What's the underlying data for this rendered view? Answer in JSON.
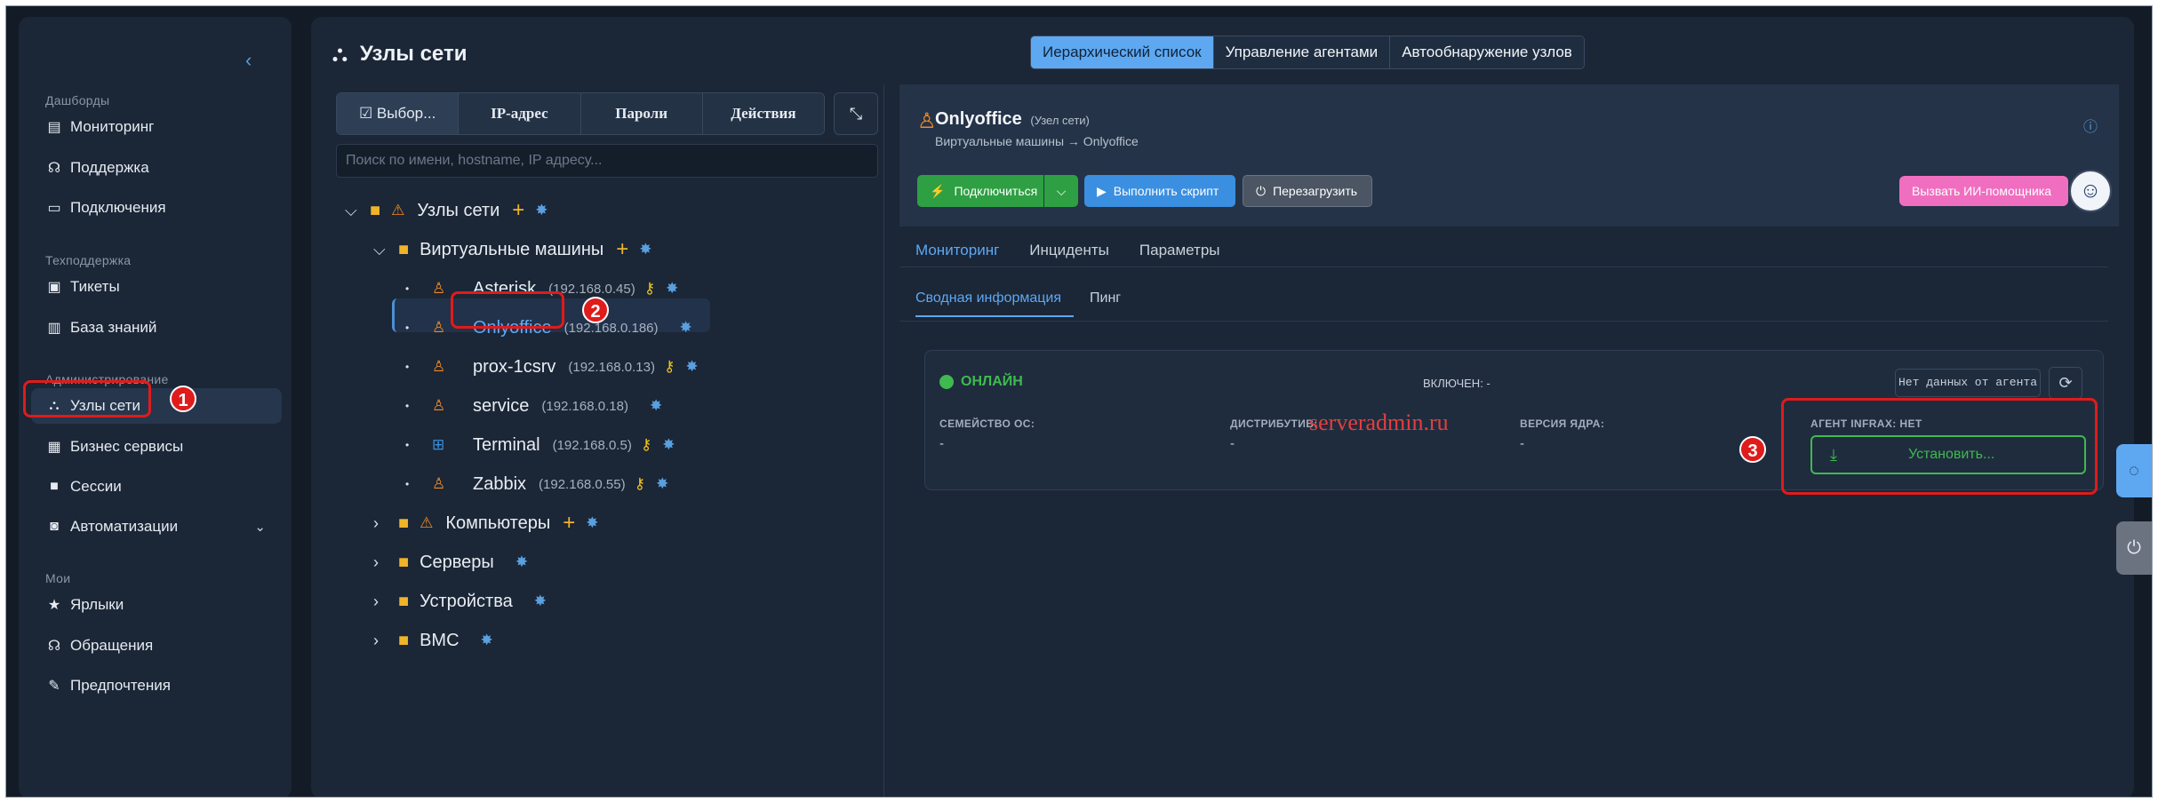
{
  "sidebar": {
    "collapse": "‹",
    "sections": [
      {
        "title": "Дашборды"
      },
      {
        "title": "Техподдержка"
      },
      {
        "title": "Администрирование"
      },
      {
        "title": "Мои"
      }
    ],
    "items": [
      {
        "label": "Мониторинг",
        "icon": "server-icon"
      },
      {
        "label": "Поддержка",
        "icon": "headset-icon"
      },
      {
        "label": "Подключения",
        "icon": "desktop-icon"
      },
      {
        "label": "Тикеты",
        "icon": "ticket-icon"
      },
      {
        "label": "База знаний",
        "icon": "book-icon"
      },
      {
        "label": "Узлы сети",
        "icon": "sitemap-icon",
        "active": true
      },
      {
        "label": "Бизнес сервисы",
        "icon": "briefcase-icon"
      },
      {
        "label": "Сессии",
        "icon": "video-icon"
      },
      {
        "label": "Автоматизации",
        "icon": "robot-icon"
      },
      {
        "label": "Ярлыки",
        "icon": "star-icon"
      },
      {
        "label": "Обращения",
        "icon": "headphones-icon"
      },
      {
        "label": "Предпочтения",
        "icon": "wrench-icon"
      }
    ]
  },
  "page": {
    "title": "Узлы сети",
    "tabs": [
      "Иерархический список",
      "Управление агентами",
      "Автообнаружение узлов"
    ],
    "active_tab": "Иерархический список"
  },
  "tree_toolbar": {
    "select_label": "☑ Выбор...",
    "ip_label": "IP-адрес",
    "passwords_label": "Пароли",
    "actions_label": "Действия",
    "search_placeholder": "Поиск по имени, hostname, IP адресу..."
  },
  "tree": {
    "root": "Узлы сети",
    "vm_folder": "Виртуальные машины",
    "hosts": [
      {
        "name": "Asterisk",
        "ip": "(192.168.0.45)",
        "os": "linux",
        "key": true
      },
      {
        "name": "Onlyoffice",
        "ip": "(192.168.0.186)",
        "os": "linux",
        "key": false,
        "selected": true
      },
      {
        "name": "prox-1csrv",
        "ip": "(192.168.0.13)",
        "os": "linux",
        "key": true
      },
      {
        "name": "service",
        "ip": "(192.168.0.18)",
        "os": "linux",
        "key": false
      },
      {
        "name": "Terminal",
        "ip": "(192.168.0.5)",
        "os": "windows",
        "key": true
      },
      {
        "name": "Zabbix",
        "ip": "(192.168.0.55)",
        "os": "linux",
        "key": true
      }
    ],
    "folders": [
      "Компьютеры",
      "Серверы",
      "Устройства",
      "BMC"
    ]
  },
  "detail": {
    "name": "Onlyoffice",
    "type": "(Узел сети)",
    "breadcrumb": "Виртуальные машины → Onlyoffice",
    "buttons": {
      "connect": "Подключиться",
      "run_script": "Выполнить скрипт",
      "reboot": "Перезагрузить",
      "ai": "Вызвать ИИ-помощника"
    },
    "tabs": [
      "Мониторинг",
      "Инциденты",
      "Параметры"
    ],
    "subtabs": [
      "Сводная информация",
      "Пинг"
    ],
    "status": "ОНЛАЙН",
    "enabled": "ВКЛЮЧЕН: -",
    "agent_data": "Нет данных от агента",
    "fields": [
      {
        "label": "СЕМЕЙСТВО ОС:",
        "value": "-"
      },
      {
        "label": "ДИСТРИБУТИВ:",
        "value": "-"
      },
      {
        "label": "ВЕРСИЯ ЯДРА:",
        "value": "-"
      }
    ],
    "agent_label": "АГЕНТ INFRAX: НЕТ",
    "install": "Установить..."
  },
  "watermark": "serveradmin.ru",
  "annotations": [
    "1",
    "2",
    "3"
  ],
  "colors": {
    "accent": "#5ea8f2",
    "online": "#3fb950",
    "annotation": "#e01b1b",
    "folder": "#f0b429",
    "warning": "#f08a24"
  }
}
